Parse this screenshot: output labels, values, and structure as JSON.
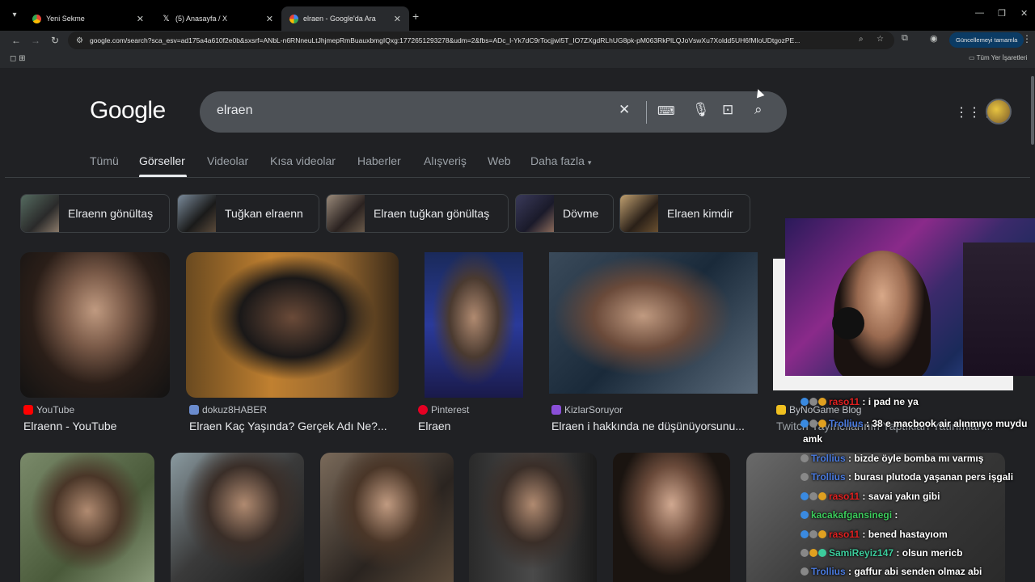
{
  "browser": {
    "tabs": [
      {
        "title": "Yeni Sekme",
        "active": false
      },
      {
        "title": "(5) Anasayfa / X",
        "active": false
      },
      {
        "title": "elraen - Google'da Ara",
        "active": true
      }
    ],
    "url": "google.com/search?sca_esv=ad175a4a610f2e0b&sxsrf=ANbL-n6RNneuLtJhjmepRmBuauxbmgIQxg:1772651293278&udm=2&fbs=ADc_l-Yk7dC9rTocjjwI5T_IO7ZXgdRLhUG8pk-pM063RkPlLQJoVswXu7Xoldd5UH6fMIoUDtgozPE...",
    "update_label": "Güncellemeyi tamamla",
    "all_bookmarks_label": "Tüm Yer İşaretleri"
  },
  "google": {
    "logo": "Google",
    "query": "elraen",
    "tabs": [
      "Tümü",
      "Görseller",
      "Videolar",
      "Kısa videolar",
      "Haberler",
      "Alışveriş",
      "Web",
      "Daha fazla"
    ],
    "active_tab": "Görseller",
    "chips": [
      "Elraenn gönültaş",
      "Tuğkan elraenn",
      "Elraen tuğkan gönültaş",
      "Dövme",
      "Elraen kimdir"
    ],
    "results": [
      {
        "source": "YouTube",
        "caption": "Elraenn - YouTube",
        "color": "#ff0000"
      },
      {
        "source": "dokuz8HABER",
        "caption": "Elraen Kaç Yaşında? Gerçek Adı Ne?...",
        "color": "#6b8cce"
      },
      {
        "source": "Pinterest",
        "caption": "Elraen",
        "color": "#e60023"
      },
      {
        "source": "KizlarSoruyor",
        "caption": "Elraen i hakkında ne düşünüyorsunu...",
        "color": "#8a4fd8"
      },
      {
        "source": "ByNoGame Blog",
        "caption": "Twitch Yayıncılarının Yaptıkları Yatırımları...",
        "color": "#f0c020"
      }
    ]
  },
  "chat": [
    {
      "user": "raso11",
      "text": ": i pad ne ya",
      "user_color": "#e02020"
    },
    {
      "user": "Trollius",
      "text": ": 38 e macbook air alınmıyo muydu",
      "user_color": "#4a7be0"
    },
    {
      "user": "",
      "text": "amk",
      "user_color": "#ffffff"
    },
    {
      "user": "Trollius",
      "text": ": bizde öyle bomba mı varmış",
      "user_color": "#4a7be0"
    },
    {
      "user": "Trollius",
      "text": ": burası plutoda yaşanan pers işgali",
      "user_color": "#4a7be0"
    },
    {
      "user": "raso11",
      "text": ": savai yakın gibi",
      "user_color": "#e02020"
    },
    {
      "user": "kacakafgansinegi",
      "text": ":",
      "user_color": "#3ccc5c"
    },
    {
      "user": "raso11",
      "text": ": bened hastayıom",
      "user_color": "#e02020"
    },
    {
      "user": "SamiReyiz147",
      "text": ": olsun mericb",
      "user_color": "#3ccc9c"
    },
    {
      "user": "Trollius",
      "text": ": gaffur abi senden olmaz abi",
      "user_color": "#4a7be0"
    }
  ]
}
